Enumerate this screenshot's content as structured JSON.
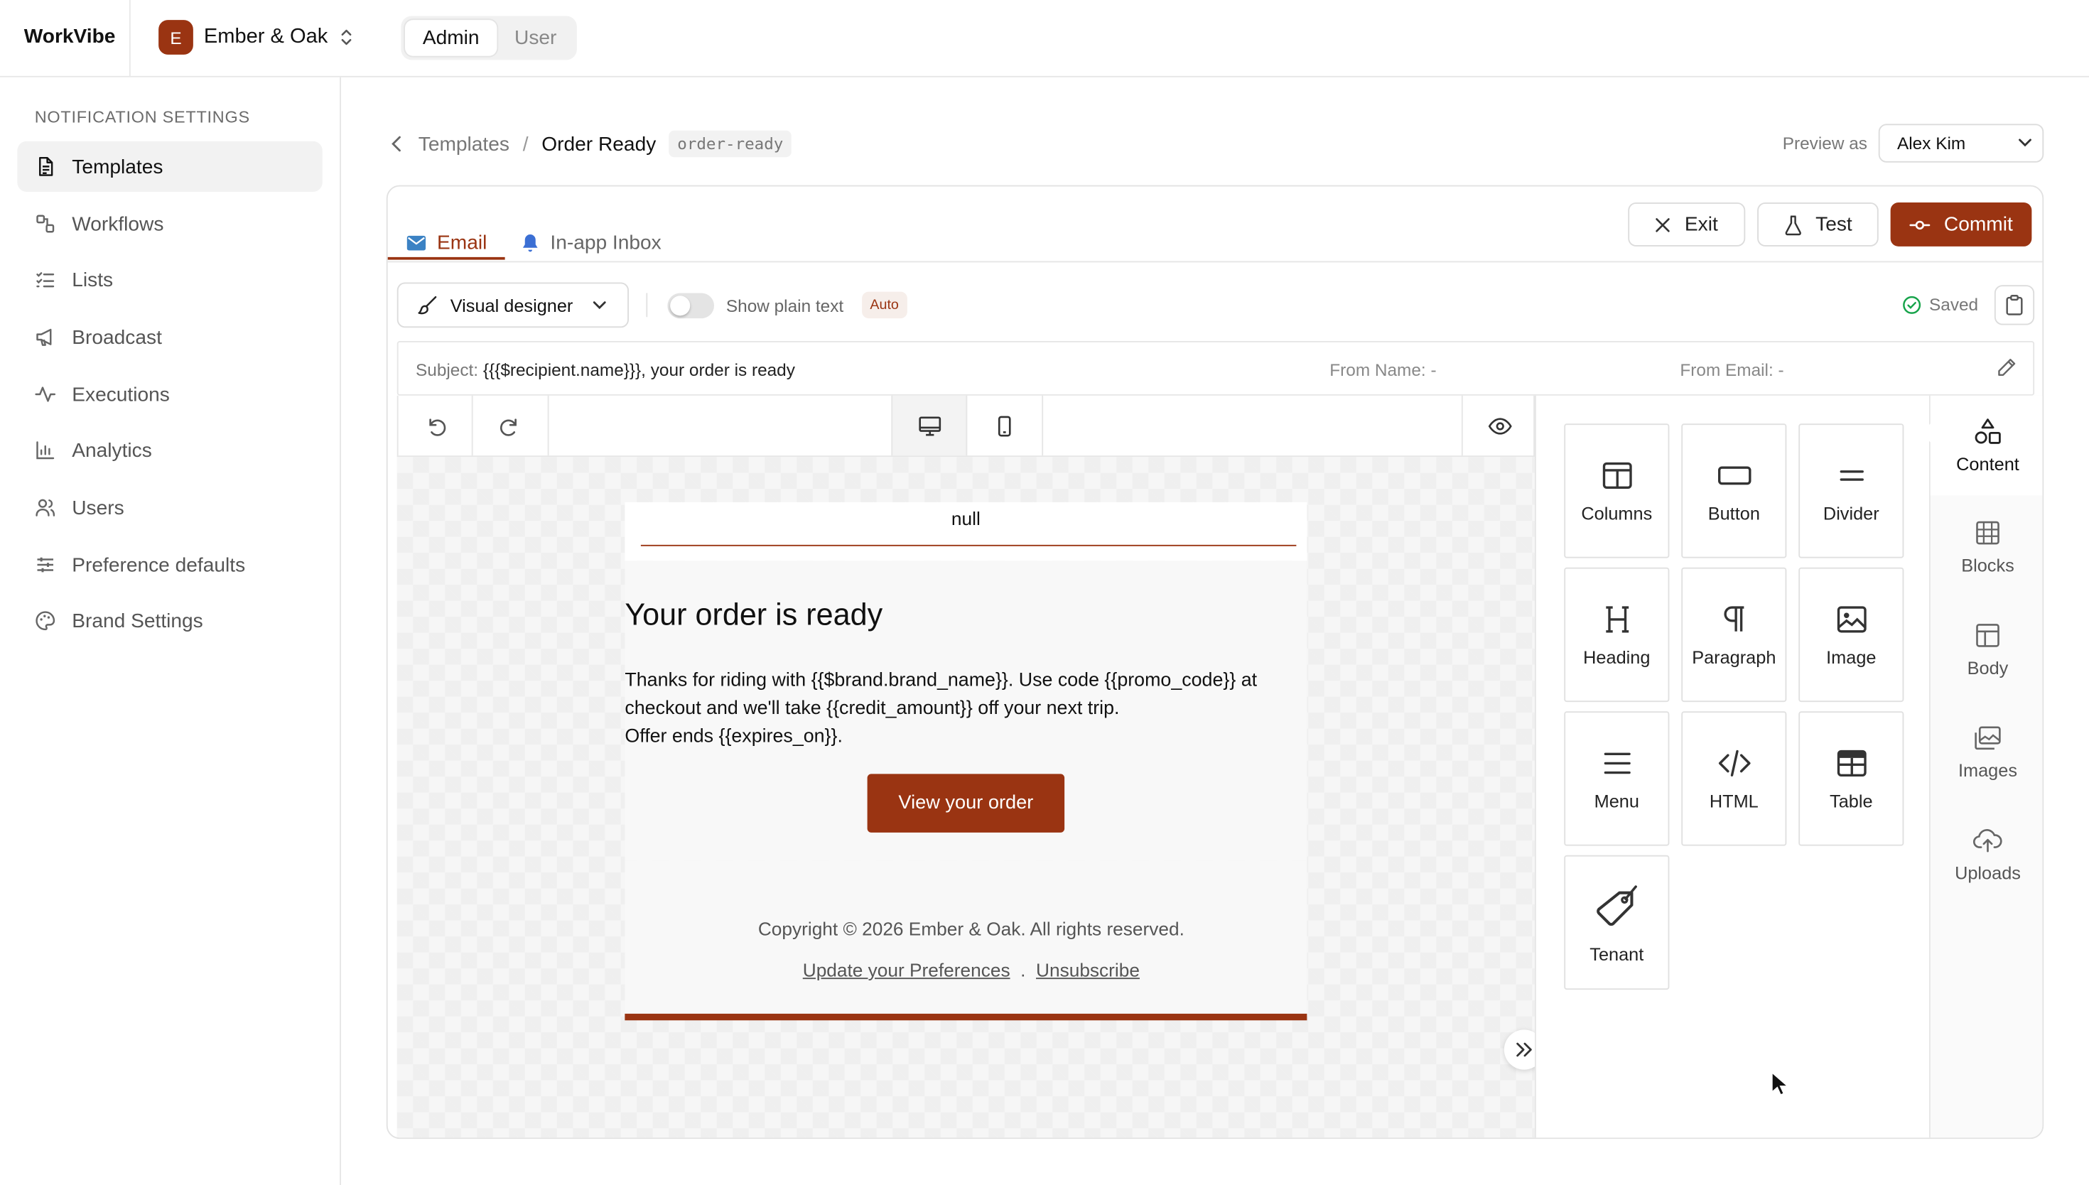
{
  "app": {
    "name": "WorkVibe"
  },
  "tenant": {
    "initial": "E",
    "name": "Ember & Oak"
  },
  "role_switch": {
    "admin": "Admin",
    "user": "User",
    "selected": "Admin"
  },
  "sidebar": {
    "section_title": "NOTIFICATION SETTINGS",
    "items": [
      {
        "label": "Templates",
        "icon": "document-icon",
        "active": true
      },
      {
        "label": "Workflows",
        "icon": "workflow-icon",
        "active": false
      },
      {
        "label": "Lists",
        "icon": "list-icon",
        "active": false
      },
      {
        "label": "Broadcast",
        "icon": "megaphone-icon",
        "active": false
      },
      {
        "label": "Executions",
        "icon": "activity-icon",
        "active": false
      },
      {
        "label": "Analytics",
        "icon": "bar-chart-icon",
        "active": false
      },
      {
        "label": "Users",
        "icon": "users-icon",
        "active": false
      },
      {
        "label": "Preference defaults",
        "icon": "sliders-icon",
        "active": false
      },
      {
        "label": "Brand Settings",
        "icon": "palette-icon",
        "active": false
      }
    ]
  },
  "breadcrumb": {
    "parent": "Templates",
    "separator": "/",
    "current": "Order Ready",
    "slug": "order-ready"
  },
  "preview": {
    "label": "Preview as",
    "selected": "Alex Kim"
  },
  "editor": {
    "tabs": [
      {
        "label": "Email",
        "icon": "mail-icon",
        "active": true
      },
      {
        "label": "In-app Inbox",
        "icon": "bell-icon",
        "active": false
      }
    ],
    "actions": {
      "exit": "Exit",
      "test": "Test",
      "commit": "Commit"
    },
    "designer_mode": "Visual designer",
    "plain_text_label": "Show plain text",
    "plain_text_enabled": false,
    "auto_badge": "Auto",
    "status": "Saved",
    "subject_label": "Subject:",
    "subject_value": "{{{$recipient.name}}}, your order is ready",
    "from_name": "From Name: -",
    "from_email": "From Email: -"
  },
  "email_preview": {
    "header_text": "null",
    "headline": "Your order is ready",
    "body_lines": [
      "Thanks for riding with {{$brand.brand_name}}. Use code {{promo_code}} at",
      "checkout and we'll take {{credit_amount}} off your next trip.",
      "Offer ends {{expires_on}}."
    ],
    "cta_label": "View your order",
    "footer_copyright": "Copyright © 2026 Ember & Oak. All rights reserved.",
    "footer_link_preferences": "Update your Preferences",
    "footer_link_separator": ".",
    "footer_link_unsubscribe": "Unsubscribe"
  },
  "tools": [
    {
      "label": "Columns",
      "icon": "columns-icon"
    },
    {
      "label": "Button",
      "icon": "button-icon"
    },
    {
      "label": "Divider",
      "icon": "divider-icon"
    },
    {
      "label": "Heading",
      "icon": "heading-icon"
    },
    {
      "label": "Paragraph",
      "icon": "paragraph-icon"
    },
    {
      "label": "Image",
      "icon": "image-icon"
    },
    {
      "label": "Menu",
      "icon": "menu-icon"
    },
    {
      "label": "HTML",
      "icon": "code-icon"
    },
    {
      "label": "Table",
      "icon": "table-icon"
    },
    {
      "label": "Tenant",
      "icon": "tag-icon"
    }
  ],
  "rail": [
    {
      "label": "Content",
      "icon": "shapes-icon",
      "active": true
    },
    {
      "label": "Blocks",
      "icon": "blocks-icon",
      "active": false
    },
    {
      "label": "Body",
      "icon": "layout-icon",
      "active": false
    },
    {
      "label": "Images",
      "icon": "images-icon",
      "active": false
    },
    {
      "label": "Uploads",
      "icon": "cloud-upload-icon",
      "active": false
    }
  ],
  "colors": {
    "brand": "#9a3412",
    "text": "#111111",
    "muted": "#777777",
    "border": "#e2e2e2"
  }
}
